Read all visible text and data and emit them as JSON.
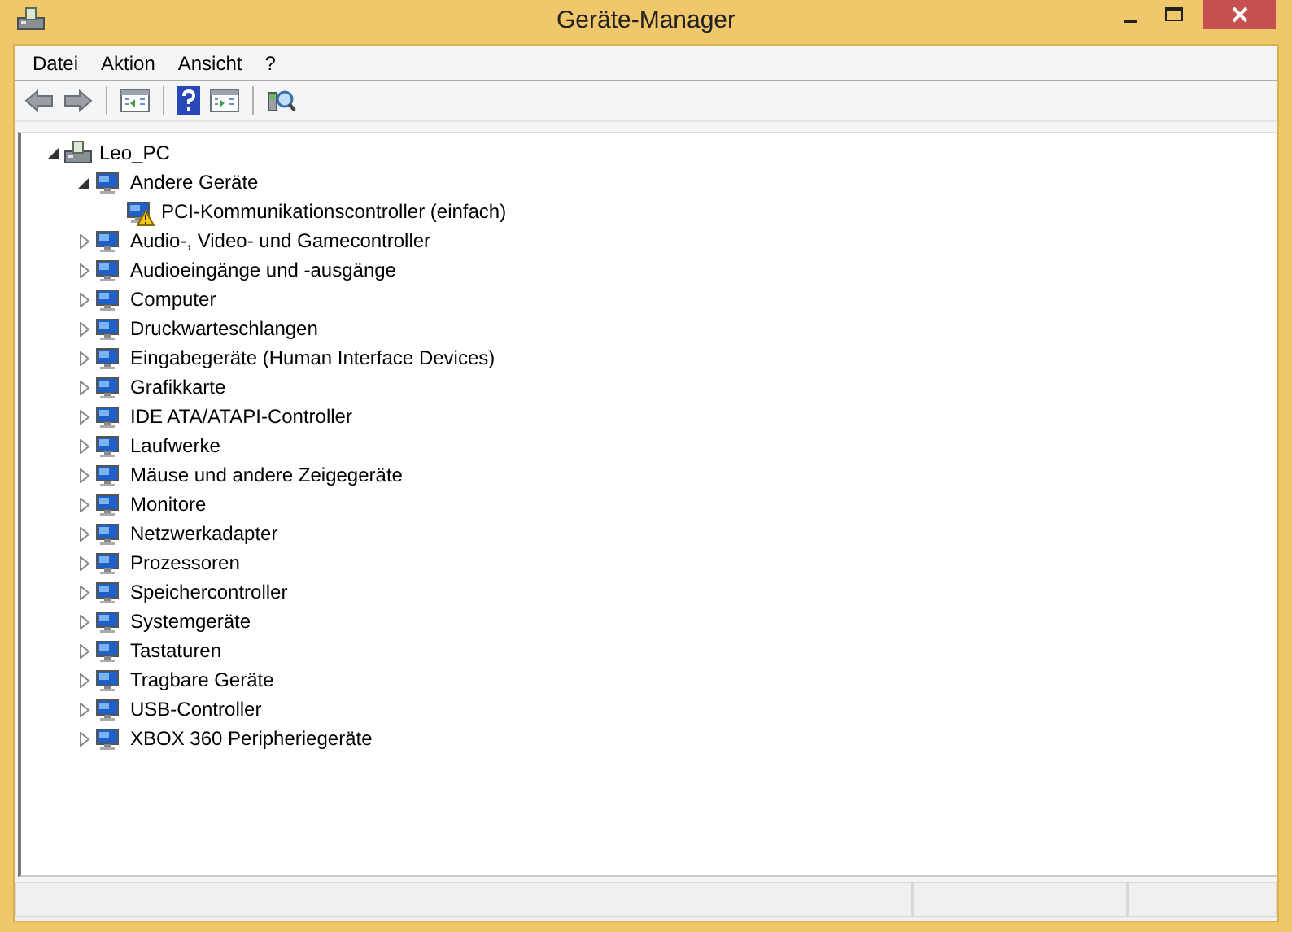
{
  "window": {
    "title": "Geräte-Manager"
  },
  "menu": [
    "Datei",
    "Aktion",
    "Ansicht",
    "?"
  ],
  "tree": [
    {
      "label": "Leo_PC",
      "expanded": true,
      "children": [
        {
          "label": "Andere Geräte",
          "expanded": true,
          "children": [
            {
              "label": "PCI-Kommunikationscontroller (einfach)",
              "warning": true
            }
          ]
        },
        {
          "label": "Audio-, Video- und Gamecontroller",
          "expanded": false
        },
        {
          "label": "Audioeingänge und -ausgänge",
          "expanded": false
        },
        {
          "label": "Computer",
          "expanded": false
        },
        {
          "label": "Druckwarteschlangen",
          "expanded": false
        },
        {
          "label": "Eingabegeräte (Human Interface Devices)",
          "expanded": false
        },
        {
          "label": "Grafikkarte",
          "expanded": false
        },
        {
          "label": "IDE ATA/ATAPI-Controller",
          "expanded": false
        },
        {
          "label": "Laufwerke",
          "expanded": false
        },
        {
          "label": "Mäuse und andere Zeigegeräte",
          "expanded": false
        },
        {
          "label": "Monitore",
          "expanded": false
        },
        {
          "label": "Netzwerkadapter",
          "expanded": false
        },
        {
          "label": "Prozessoren",
          "expanded": false
        },
        {
          "label": "Speichercontroller",
          "expanded": false
        },
        {
          "label": "Systemgeräte",
          "expanded": false
        },
        {
          "label": "Tastaturen",
          "expanded": false
        },
        {
          "label": "Tragbare Geräte",
          "expanded": false
        },
        {
          "label": "USB-Controller",
          "expanded": false
        },
        {
          "label": "XBOX 360 Peripheriegeräte",
          "expanded": false
        }
      ]
    }
  ]
}
